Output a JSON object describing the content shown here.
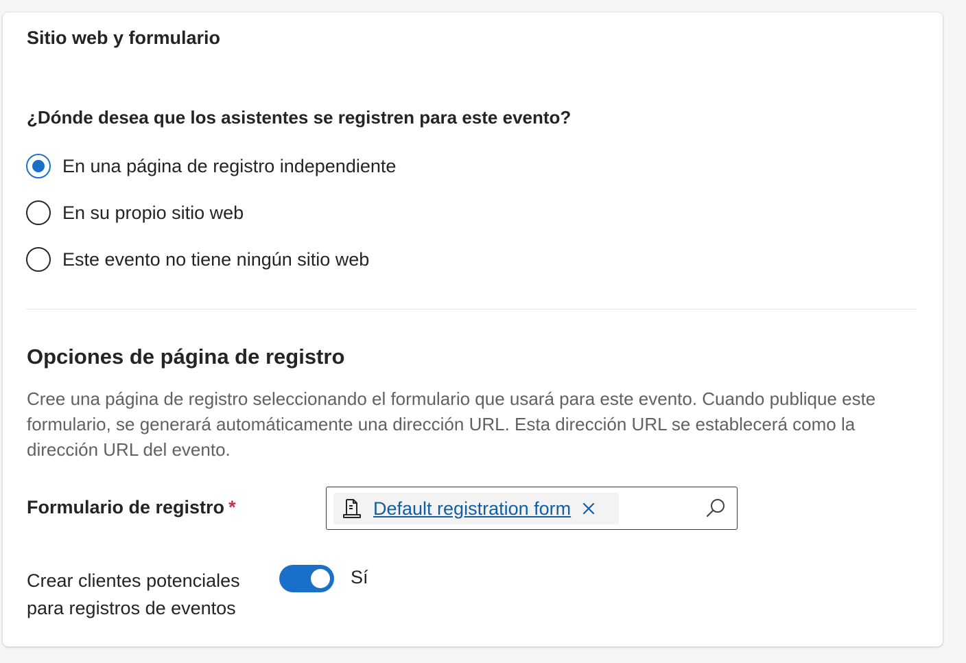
{
  "card": {
    "title": "Sitio web y formulario"
  },
  "registration_location": {
    "question": "¿Dónde desea que los asistentes se registren para este evento?",
    "options": [
      {
        "label": "En una página de registro independiente",
        "checked": true
      },
      {
        "label": "En su propio sitio web",
        "checked": false
      },
      {
        "label": "Este evento no tiene ningún sitio web",
        "checked": false
      }
    ]
  },
  "registration_page": {
    "title": "Opciones de página de registro",
    "description": "Cree una página de registro seleccionando el formulario que usará para este evento. Cuando publique este formulario, se generará automáticamente una dirección URL. Esta dirección URL se establecerá como la dirección URL del evento.",
    "form_field": {
      "label": "Formulario de registro",
      "required_mark": "*",
      "value": "Default registration form",
      "icon": "form-document-icon"
    },
    "leads_toggle": {
      "label": "Crear clientes potenciales para registros de eventos",
      "value_label": "Sí",
      "on": true
    }
  },
  "colors": {
    "accent": "#1a6fc9",
    "link": "#115ea3",
    "required": "#c4314b",
    "secondary_text": "#616161"
  }
}
